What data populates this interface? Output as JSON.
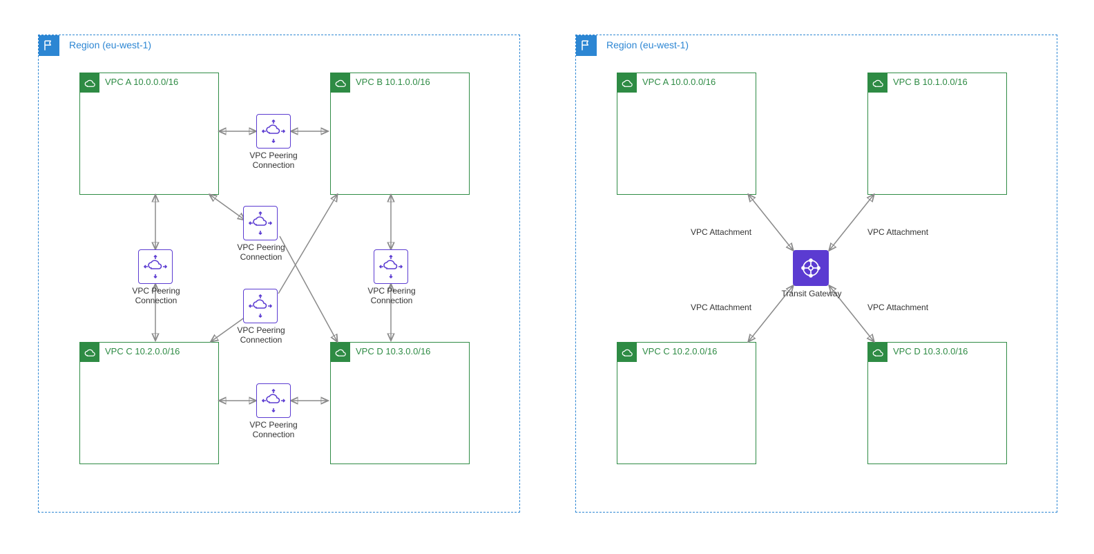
{
  "left": {
    "region_label": "Region (eu-west-1)",
    "vpc_a": "VPC A 10.0.0.0/16",
    "vpc_b": "VPC B 10.1.0.0/16",
    "vpc_c": "VPC C 10.2.0.0/16",
    "vpc_d": "VPC D 10.3.0.0/16",
    "peering_label": "VPC Peering\nConnection"
  },
  "right": {
    "region_label": "Region (eu-west-1)",
    "vpc_a": "VPC A 10.0.0.0/16",
    "vpc_b": "VPC B 10.1.0.0/16",
    "vpc_c": "VPC C 10.2.0.0/16",
    "vpc_d": "VPC D 10.3.0.0/16",
    "tgw_label": "Transit Gateway",
    "attach_label": "VPC Attachment"
  }
}
